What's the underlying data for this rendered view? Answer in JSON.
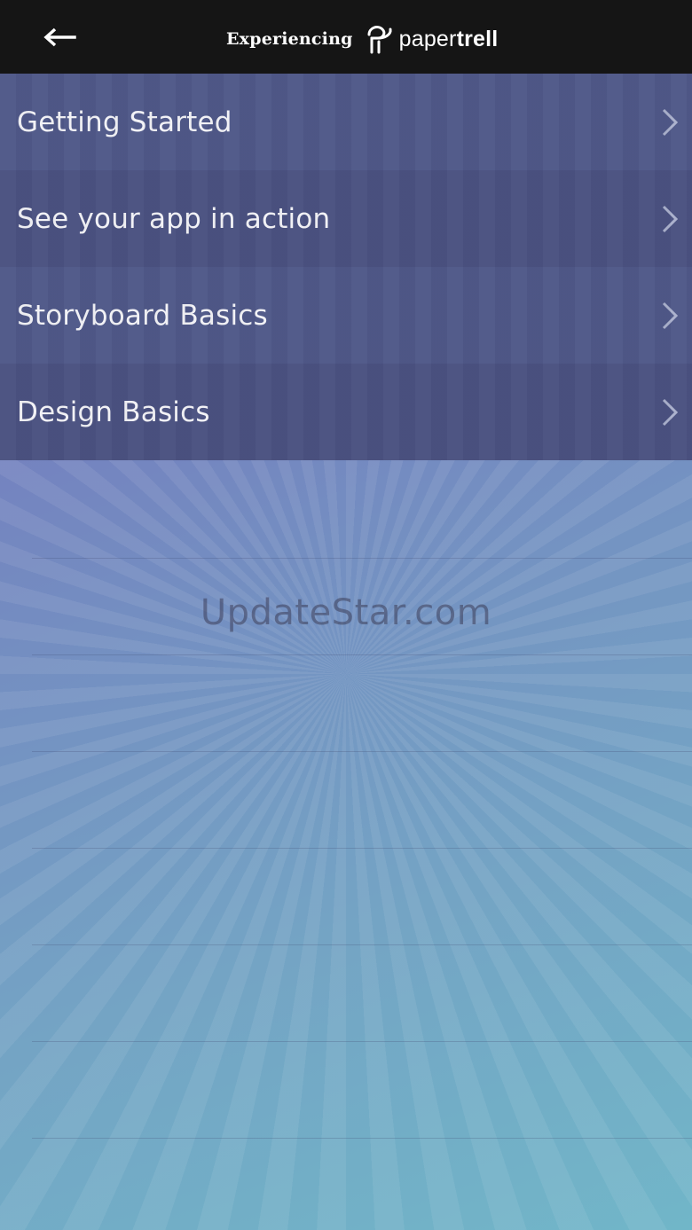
{
  "header": {
    "brand_prefix": "Experiencing",
    "brand_name_light": "paper",
    "brand_name_bold": "trell"
  },
  "menu": {
    "items": [
      {
        "label": "Getting Started"
      },
      {
        "label": "See your app in action"
      },
      {
        "label": "Storyboard Basics"
      },
      {
        "label": "Design Basics"
      }
    ]
  },
  "watermark": "UpdateStar.com",
  "colors": {
    "header_bg": "#151515",
    "menu_row_a": "#4f5888",
    "menu_row_b": "#4a5180",
    "gradient_top": "#7b68b8",
    "gradient_bottom": "#71b6c8"
  },
  "icons": {
    "back": "arrow-left-icon",
    "logo": "papertrell-logo-icon",
    "row": "chevron-right-icon"
  }
}
